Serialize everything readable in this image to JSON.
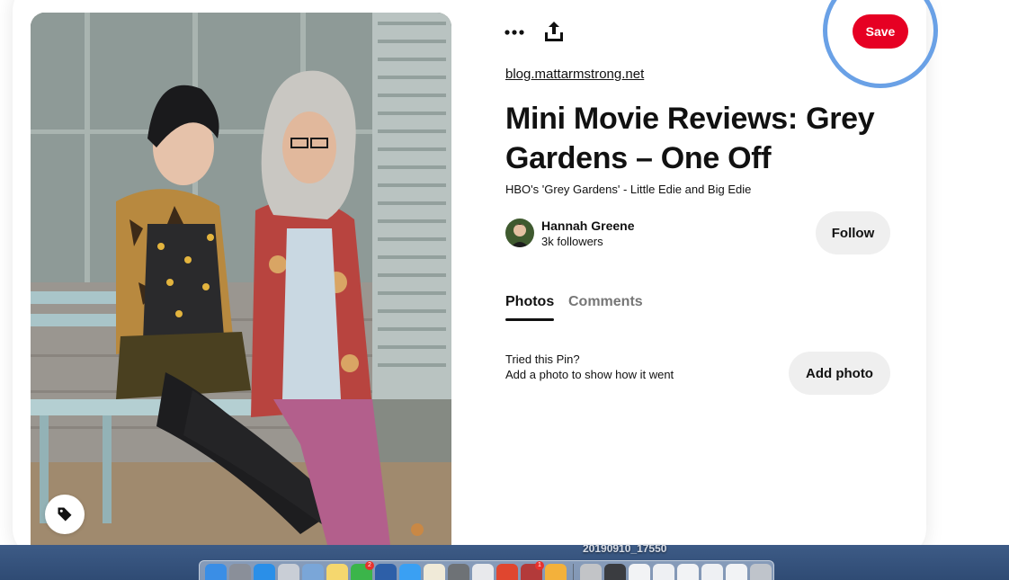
{
  "pin": {
    "source_link": "blog.mattarmstrong.net",
    "title": "Mini Movie Reviews: Grey Gardens – One Off",
    "description": "HBO's 'Grey Gardens' - Little Edie and Big Edie",
    "save_label": "Save"
  },
  "creator": {
    "name": "Hannah Greene",
    "followers": "3k followers",
    "follow_label": "Follow"
  },
  "tabs": [
    {
      "label": "Photos",
      "active": true
    },
    {
      "label": "Comments",
      "active": false
    }
  ],
  "tried": {
    "heading": "Tried this Pin?",
    "subtext": "Add a photo to show how it went",
    "button_label": "Add photo"
  },
  "icons": {
    "more": "ellipsis-icon",
    "share": "share-upload-icon",
    "tag": "tag-icon"
  },
  "colors": {
    "save_red": "#e60023",
    "focus_ring": "#6aa1e6",
    "secondary_button": "#efefef"
  },
  "dock": {
    "desktop_label": "20190910_17550",
    "apps": [
      {
        "name": "finder-icon",
        "color": "#3a8ee6"
      },
      {
        "name": "launchpad-icon",
        "color": "#8a8f99"
      },
      {
        "name": "safari-icon",
        "color": "#2a8fe8"
      },
      {
        "name": "help-icon",
        "color": "#c9ced6"
      },
      {
        "name": "preview-icon",
        "color": "#7aa6d8"
      },
      {
        "name": "notes-icon",
        "color": "#f5d76e"
      },
      {
        "name": "facetime-icon",
        "color": "#3bb54a",
        "badge": "2"
      },
      {
        "name": "quicktime-icon",
        "color": "#2d5fa8"
      },
      {
        "name": "messages-icon",
        "color": "#3aa0f3"
      },
      {
        "name": "textedit-icon",
        "color": "#f0ead8"
      },
      {
        "name": "system-preferences-icon",
        "color": "#6e7276"
      },
      {
        "name": "calendar-icon",
        "color": "#e8e9ec"
      },
      {
        "name": "chrome-icon",
        "color": "#e0462f"
      },
      {
        "name": "photo-booth-icon",
        "color": "#b33a3a",
        "badge": "1"
      },
      {
        "name": "photos-icon",
        "color": "#f3b13b"
      }
    ],
    "files": [
      {
        "name": "screenshot-thumbnail-icon",
        "color": "#c2c4c7"
      },
      {
        "name": "screenshot-thumbnail-icon",
        "color": "#3a3c40"
      },
      {
        "name": "document-thumbnail-icon",
        "color": "#f2f3f5"
      },
      {
        "name": "document-thumbnail-icon",
        "color": "#eef0f3"
      },
      {
        "name": "document-thumbnail-icon",
        "color": "#f2f3f5"
      },
      {
        "name": "document-thumbnail-icon",
        "color": "#eef0f3"
      },
      {
        "name": "document-thumbnail-icon",
        "color": "#f2f3f5"
      },
      {
        "name": "trash-icon",
        "color": "#bfc4cb"
      }
    ]
  }
}
